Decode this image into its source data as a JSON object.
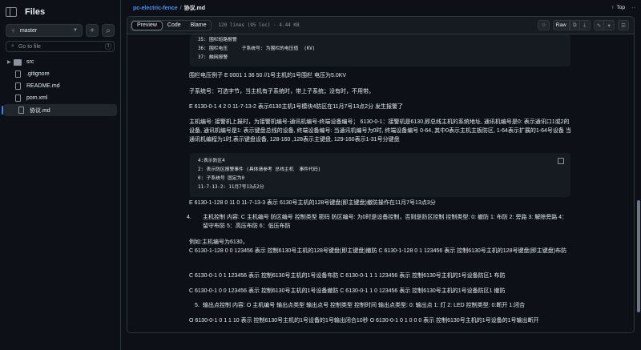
{
  "sidebar": {
    "title": "Files",
    "branch": "master",
    "add_icon": "+",
    "search_icon": "⌕",
    "search_placeholder": "Go to file",
    "search_shortcut": "t",
    "items": [
      {
        "label": "src",
        "type": "folder"
      },
      {
        "label": ".gitignore",
        "type": "file"
      },
      {
        "label": "README.md",
        "type": "file"
      },
      {
        "label": "pom.xml",
        "type": "file"
      },
      {
        "label": "协议.md",
        "type": "file",
        "active": true
      }
    ]
  },
  "breadcrumb": {
    "repo": "pc-electric-fence",
    "sep": "/",
    "file": "协议.md"
  },
  "top_link": {
    "arrow": "↑",
    "label": "Top"
  },
  "more": "···",
  "file_header": {
    "tabs": [
      "Preview",
      "Code",
      "Blame"
    ],
    "active_tab": "Preview",
    "info": "120 lines (95 loc) · 4.44 KB",
    "raw_label": "Raw",
    "copilot_icon": "☺",
    "copy_icon": "⧉",
    "download_icon": "⤓",
    "edit_icon": "✎",
    "caret_icon": "▾",
    "list_icon": "☰"
  },
  "code_block_1": [
    "35: 围栏短路报警",
    "36: 围栏电压     子系统号: 为围栏的电压值  (KV)",
    "37: 触网报警"
  ],
  "paragraphs": {
    "p1": "围栏电压例子 E 0001 1 36 50 //1号主机的1号围栏 电压为5.0KV",
    "p2": "子系统号：可选字节，当主机有子系统时，带上子系统；没有时，不用带。",
    "p3": "E 6130-0-1 4 2 0 11-7-13-2 表示6130主机1号模块4防区在11月7号13点2分 发生报警了",
    "p4": "主机编号: 接警机上报时，为接警机编号-通讯机编号-终端设备编号； 6130-0-1：接警机是6130,即总线主机的系统地址, 通讯机编号是0: 表示通讯口1或2的设备, 通讯机编号是1: 表示键盘总线的设备, 终端设备编号: 当通讯机编号为0时, 终端设备编号 0-64, 其中0表示主机主板防区, 1-64表示扩展的1-64号设备 当通讯机编程为1时,表示键盘设备, 128-160 ,128表示主键盘, 129-160表示1-31号分键盘",
    "p5": "E 6130-1-128 0 11 0 11-7-13-3 表示 6130号主机的128号键盘(即主键盘)撤防操作在11月7号13点3分",
    "li4_num": "4.",
    "li4": "主机控制 内容: C 主机编号 防区编号 控制类型 密码 防区编号: 为0时是设备控制，否则是防区控制 控制类型: 0: 撤防 1: 布防 2: 旁路 3: 解除旁路 4：留守布防 5：高压布防 6：低压布防",
    "p6": "例如:主机编号为6130，",
    "p7": "C 6130-1-128 0 0 123456 表示 控制6130号主机的128号键盘(即主键盘)撤防 C 6130-1-128 0 1 123456 表示 控制6130号主机的128号键盘(即主键盘)布防",
    "p8": "C 6130-0-1 0 1 123456 表示 控制6130号主机的1号设备布防 C 6130-0-1 1 1 123456 表示 控制6130号主机的1号设备防区1 布防",
    "p9": "C 6130-0-1 0 0 123456 表示 控制6130号主机的1号设备撤防 C 6130-0-1 1 0 123456 表示 控制6130号主机的1号设备防区1 撤防",
    "li5_num": "5.",
    "li5": "输出点控制 内容: O 主机编号 输出点类型 输出点号 控制类型 控制时间 输出点类型: 0: 输出点 1: 灯 2: LED 控制类型: 0:断开 1:闭合",
    "p10": "O 6130-0-1 0 1 1 10 表示 控制6130号主机的1号设备的1号输出闭合10秒 O 6130-0-1 0 1 0 0 0 表示 控制6130号主机的1号设备的1号输出断开"
  },
  "code_block_2": [
    "4:表示防区4",
    "2: 表示防区报警事件 (具体请参考 总线主机  事件代码)",
    "0: 子系统号 固定为0",
    "11-7-13-2: 11月7号13点2分"
  ],
  "colors": {
    "background": "#0d1117",
    "panel": "#161b22",
    "border": "#30363d",
    "link": "#4493f8",
    "text": "#e6edf3",
    "muted": "#8b949e"
  }
}
